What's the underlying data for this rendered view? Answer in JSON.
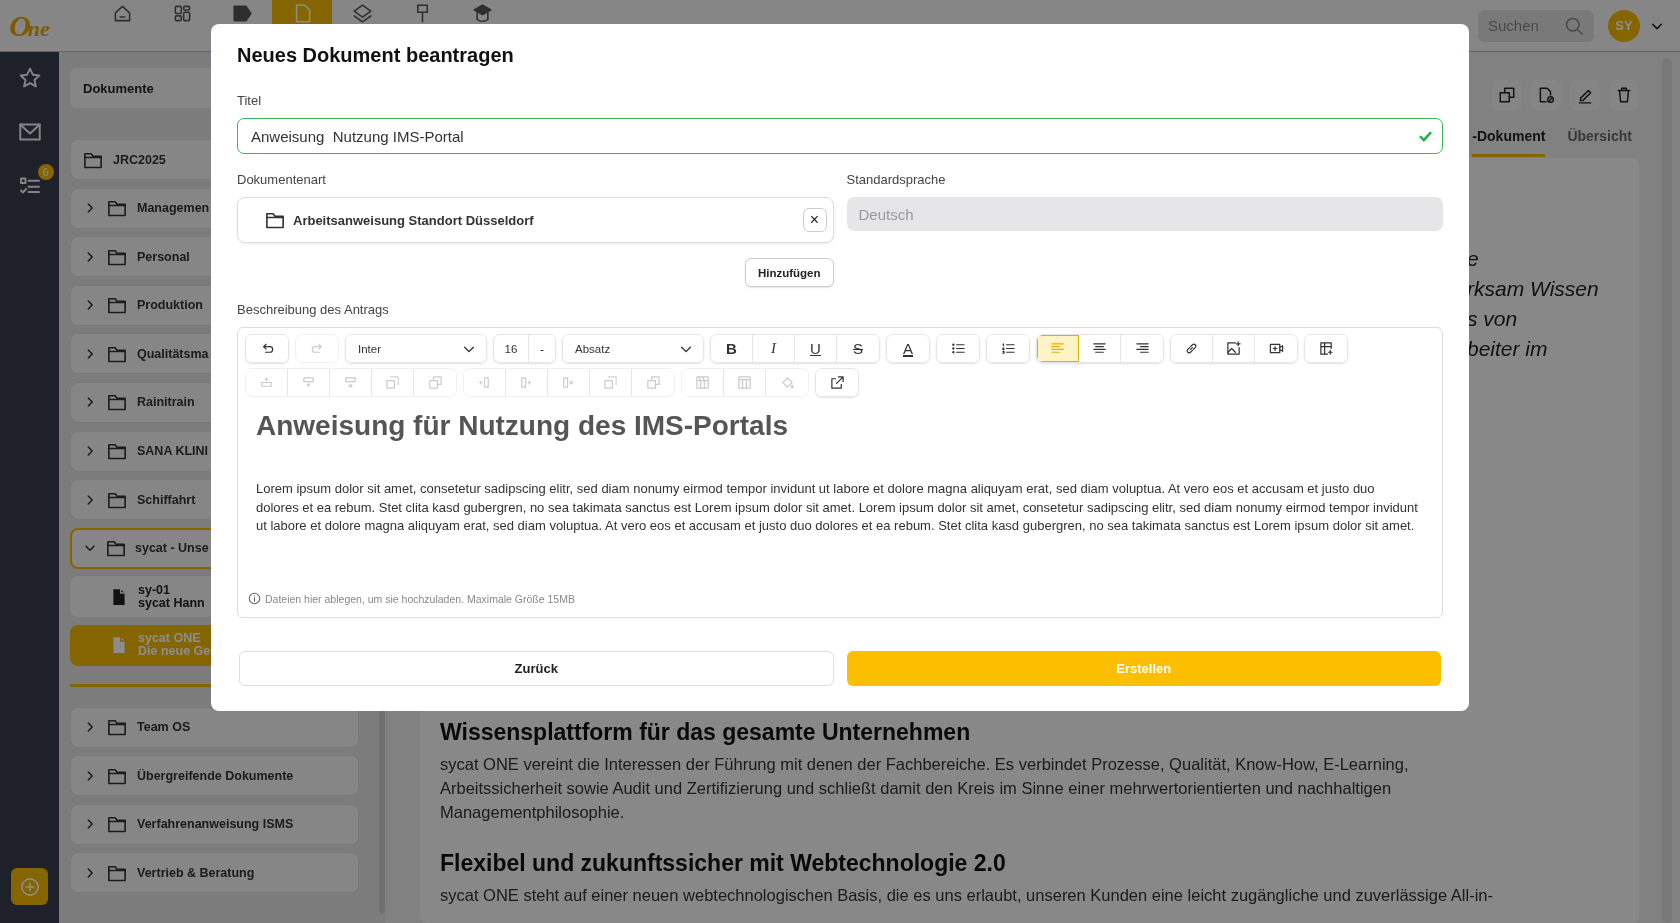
{
  "top_bar": {
    "logo": {
      "ring": "O",
      "text": "ne"
    },
    "nav": [
      {
        "kind": "home",
        "selected": false
      },
      {
        "kind": "grid",
        "selected": false
      },
      {
        "kind": "tag",
        "selected": false
      },
      {
        "kind": "document",
        "selected": true
      },
      {
        "kind": "layers",
        "selected": false
      },
      {
        "kind": "pin",
        "selected": false
      },
      {
        "kind": "cap",
        "selected": false
      }
    ],
    "search": {
      "placeholder": "Suchen"
    },
    "avatar": "SY"
  },
  "rail": {
    "items": [
      {
        "kind": "star"
      },
      {
        "kind": "mail"
      },
      {
        "kind": "tasks",
        "badge": "6"
      }
    ]
  },
  "tree": {
    "header": "Dokumente",
    "items": [
      {
        "kind": "folder",
        "label": "JRC2025",
        "expandable": false,
        "expanded": false
      },
      {
        "kind": "folder",
        "label": "Managemen",
        "expandable": true,
        "expanded": false
      },
      {
        "kind": "folder",
        "label": "Personal",
        "expandable": true,
        "expanded": false
      },
      {
        "kind": "folder",
        "label": "Produktion",
        "expandable": true,
        "expanded": false
      },
      {
        "kind": "folder",
        "label": "Qualitätsma",
        "expandable": true,
        "expanded": false
      },
      {
        "kind": "folder",
        "label": "Rainitrain",
        "expandable": true,
        "expanded": false
      },
      {
        "kind": "folder",
        "label": "SANA KLINI",
        "expandable": true,
        "expanded": false
      },
      {
        "kind": "folder",
        "label": "Schiffahrt",
        "expandable": true,
        "expanded": false
      },
      {
        "kind": "folder",
        "label": "sycat - Unse",
        "expandable": true,
        "expanded": true,
        "children": [
          {
            "kind": "document",
            "code": "sy-01",
            "title": "sycat Hann",
            "selected": false
          },
          {
            "kind": "document",
            "code": "sycat ONE",
            "title": "Die neue Ge",
            "selected": true
          }
        ]
      },
      {
        "kind": "divider"
      },
      {
        "kind": "folder",
        "label": "Team OS",
        "expandable": true,
        "expanded": false
      },
      {
        "kind": "folder",
        "label": "Übergreifende Dokumente",
        "expandable": true,
        "expanded": false
      },
      {
        "kind": "folder",
        "label": "Verfahrenanweisung ISMS",
        "expandable": true,
        "expanded": false
      },
      {
        "kind": "folder",
        "label": "Vertrieb & Beratung",
        "expandable": true,
        "expanded": false
      }
    ]
  },
  "main": {
    "actions": [
      {
        "kind": "split"
      },
      {
        "kind": "doc-block"
      },
      {
        "kind": "edit"
      },
      {
        "kind": "delete"
      }
    ],
    "tabs": [
      {
        "label": "-Dokument",
        "selected": true
      },
      {
        "label": "Übersicht",
        "selected": false
      }
    ],
    "fragments": [
      "e",
      "rksam Wissen",
      "s von",
      "beiter im"
    ],
    "sections": [
      {
        "heading": "Wissensplattform für das gesamte Unternehmen",
        "text": "sycat ONE vereint die Interessen der Führung mit denen der Fachbereiche. Es verbindet Prozesse, Qualität, Know-How, E-Learning, Arbeitssicherheit sowie Audit und Zertifizierung und schließt damit den Kreis im Sinne einer mehrwertorientierten und nachhaltigen Managementphilosophie."
      },
      {
        "heading": "Flexibel und zukunftssicher mit Webtechnologie 2.0",
        "text": "sycat ONE steht auf einer neuen webtechnologischen Basis, die es uns erlaubt, unseren Kunden eine leicht zugängliche und zuverlässige All-in-"
      }
    ]
  },
  "dialog": {
    "title": "Neues Dokument beantragen",
    "title_field": {
      "label": "Titel",
      "value": "Anweisung  Nutzung IMS-Portal",
      "valid": true
    },
    "type_field": {
      "label": "Dokumentenart",
      "value": "Arbeitsanweisung Standort Düsseldorf",
      "clear": "×"
    },
    "add_button": "Hinzufügen",
    "language_field": {
      "label": "Standardsprache",
      "value": "Deutsch",
      "disabled": true
    },
    "description_label": "Beschreibung des Antrags",
    "toolbar": [
      [
        [
          {
            "kind": "undo",
            "disabled": false
          }
        ],
        [
          {
            "kind": "redo",
            "disabled": true
          }
        ],
        [
          {
            "kind": "select",
            "label": "Inter"
          }
        ],
        [
          {
            "kind": "size",
            "label": "16",
            "step": "-"
          }
        ],
        [
          {
            "kind": "select",
            "label": "Absatz"
          }
        ],
        [
          {
            "kind": "bold",
            "glyph": "B",
            "disabled": false
          },
          {
            "kind": "italic",
            "glyph": "I",
            "disabled": false
          },
          {
            "kind": "underline",
            "glyph": "U",
            "disabled": false
          },
          {
            "kind": "strike",
            "glyph": "S",
            "disabled": false
          }
        ],
        [
          {
            "kind": "color",
            "glyph": "A",
            "disabled": false
          }
        ],
        [
          {
            "kind": "bullets",
            "disabled": false
          }
        ],
        [
          {
            "kind": "numbers",
            "disabled": false
          }
        ],
        [
          {
            "kind": "align-left",
            "disabled": false,
            "selected": true
          },
          {
            "kind": "align-center",
            "disabled": false,
            "selected": false
          },
          {
            "kind": "align-right",
            "disabled": false,
            "selected": false
          }
        ],
        [
          {
            "kind": "link",
            "disabled": false
          },
          {
            "kind": "image",
            "disabled": false
          },
          {
            "kind": "video",
            "disabled": false
          }
        ],
        [
          {
            "kind": "table",
            "disabled": false
          }
        ]
      ],
      [
        [
          {
            "kind": "row-above",
            "disabled": true
          },
          {
            "kind": "row-below",
            "disabled": true
          },
          {
            "kind": "row-delete",
            "disabled": true
          },
          {
            "kind": "merge",
            "disabled": true
          },
          {
            "kind": "split",
            "disabled": true
          }
        ],
        [
          {
            "kind": "col-left",
            "disabled": true
          },
          {
            "kind": "col-right",
            "disabled": true
          },
          {
            "kind": "col-delete",
            "disabled": true
          },
          {
            "kind": "merge",
            "disabled": true
          },
          {
            "kind": "split",
            "disabled": true
          }
        ],
        [
          {
            "kind": "table-header",
            "disabled": true
          },
          {
            "kind": "table-props",
            "disabled": true
          },
          {
            "kind": "fill",
            "disabled": true
          }
        ],
        [
          {
            "kind": "popout",
            "disabled": false
          }
        ]
      ]
    ],
    "content": {
      "heading": "Anweisung für Nutzung des IMS-Portals",
      "text": "Lorem ipsum dolor sit amet, consetetur sadipscing elitr, sed diam nonumy eirmod tempor invidunt ut labore et dolore magna aliquyam erat, sed diam voluptua. At vero eos et accusam et justo duo dolores et ea rebum. Stet clita kasd gubergren, no sea takimata sanctus est Lorem ipsum dolor sit amet. Lorem ipsum dolor sit amet, consetetur sadipscing elitr, sed diam nonumy eirmod tempor invidunt ut labore et dolore magna aliquyam erat, sed diam voluptua. At vero eos et accusam et justo duo dolores et ea rebum. Stet clita kasd gubergren, no sea takimata sanctus est Lorem ipsum dolor sit amet."
    },
    "upload_hint": "Dateien hier ablegen, um sie hochzuladen. Maximale Größe 15MB",
    "buttons": [
      {
        "kind": "secondary",
        "label": "Zurück"
      },
      {
        "kind": "primary",
        "label": "Erstellen"
      }
    ]
  }
}
